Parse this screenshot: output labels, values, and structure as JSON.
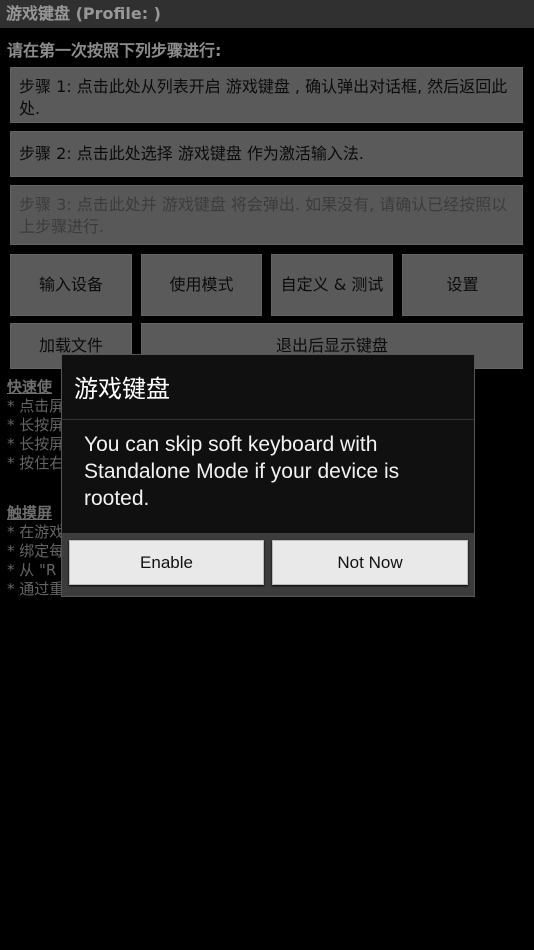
{
  "titlebar": {
    "title": "游戏键盘 (Profile: )"
  },
  "instructions": "请在第一次按照下列步骤进行:",
  "steps": [
    {
      "label": "步骤 1: 点击此处从列表开启 游戏键盘 , 确认弹出对话框, 然后返回此处."
    },
    {
      "label": "步骤 2: 点击此处选择 游戏键盘 作为激活输入法."
    },
    {
      "label": "步骤 3: 点击此处并 游戏键盘 将会弹出. 如果没有, 请确认已经按照以上步骤进行."
    }
  ],
  "buttons": {
    "input_device": "输入设备",
    "usage_mode": "使用模式",
    "customize_test": "自定义 & 测试",
    "settings": "设置",
    "load_file": "加载文件",
    "show_keyboard": "退出后显示键盘"
  },
  "quick_use": {
    "heading": "快速使",
    "lines": [
      "* 点击屏",
      "* 长按屏",
      "* 长按屏",
      "* 按住右"
    ]
  },
  "touch": {
    "heading": "触摸屏",
    "lines": [
      "* 在游戏",
      "* 绑定每",
      "* 从 \"R",
      "* 通过重新调整图标大小, 调整 拖拽/滑动范围"
    ]
  },
  "dialog": {
    "title": "游戏键盘",
    "message": "You can skip soft keyboard with Standalone Mode if your device is rooted.",
    "enable": "Enable",
    "not_now": "Not Now"
  },
  "colors": {
    "titlebar_bg": "#4a4a4a",
    "panel_bg": "#8a8a8a",
    "dialog_bg": "#101010",
    "dialog_button_bg": "#e9e9e9"
  }
}
